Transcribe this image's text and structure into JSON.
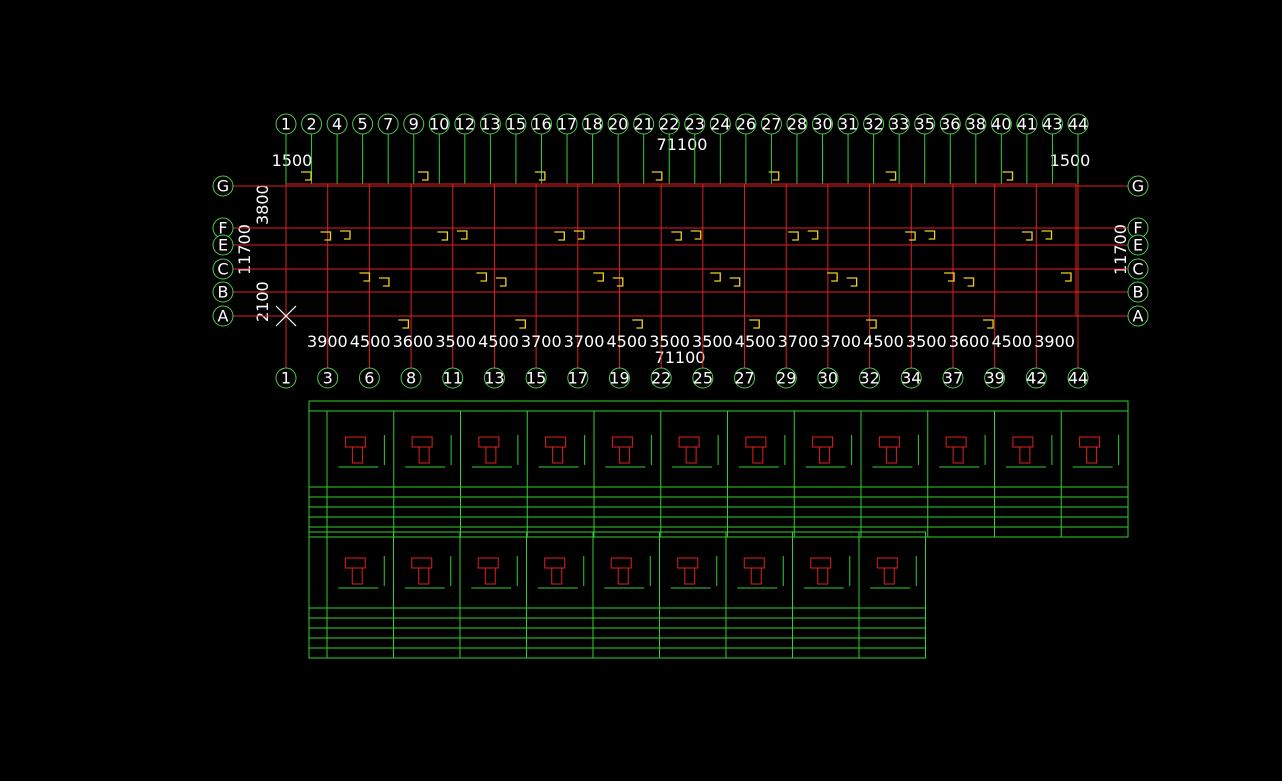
{
  "plan": {
    "top_axes": [
      "1",
      "2",
      "4",
      "5",
      "7",
      "9",
      "10",
      "12",
      "13",
      "15",
      "16",
      "17",
      "18",
      "20",
      "21",
      "22",
      "23",
      "24",
      "26",
      "27",
      "28",
      "30",
      "31",
      "32",
      "33",
      "35",
      "36",
      "38",
      "40",
      "41",
      "43",
      "44"
    ],
    "top_total": "71100",
    "top_dims_text": "1500",
    "top_dims_end": "1500",
    "bottom_axes": [
      "1",
      "3",
      "6",
      "8",
      "11",
      "13",
      "15",
      "17",
      "19",
      "22",
      "25",
      "27",
      "29",
      "30",
      "32",
      "34",
      "37",
      "39",
      "42",
      "44"
    ],
    "bottom_dims": [
      "3900",
      "4500",
      "3600",
      "3500",
      "4500",
      "3700",
      "3700",
      "4500",
      "3500",
      "3500",
      "4500",
      "3700",
      "3700",
      "4500",
      "3500",
      "3600",
      "4500",
      "3900"
    ],
    "bottom_total": "71100",
    "row_axes": [
      "G",
      "F",
      "E",
      "C",
      "B",
      "A"
    ],
    "left_total": "11700",
    "right_total": "11700",
    "left_dim_top": "3800",
    "left_dim_bottom": "2100"
  },
  "colors": {
    "grid": "#e02020",
    "axis": "#4ecb4e",
    "wall": "#f0d020",
    "table": "#2fd02f",
    "background": "#000000"
  }
}
